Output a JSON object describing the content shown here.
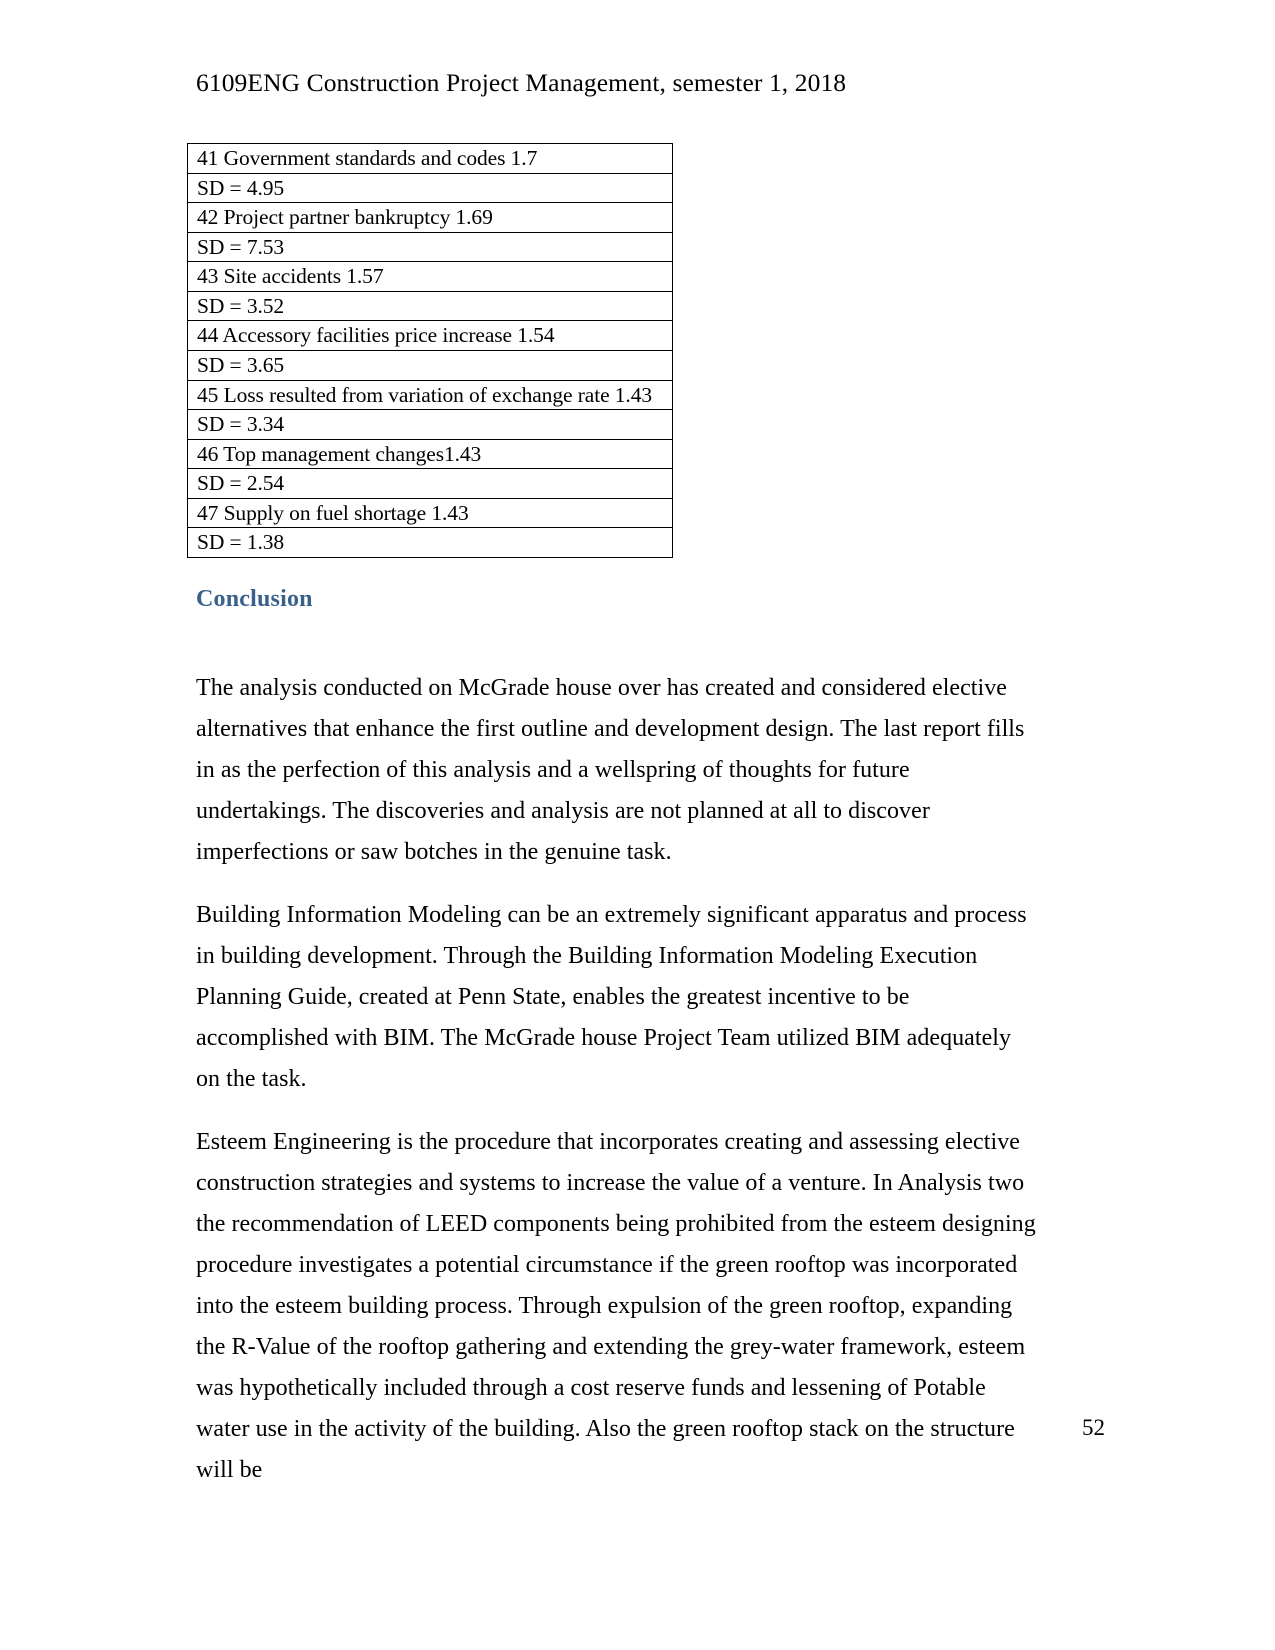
{
  "document": {
    "header": "6109ENG Construction Project Management, semester 1, 2018",
    "page_number": "52",
    "heading_color": "#38618c"
  },
  "risk_table": {
    "rows": [
      {
        "label": "41 Government standards and codes 1.7",
        "sd": "SD = 4.95"
      },
      {
        "label": "42 Project partner bankruptcy   1.69",
        "sd": "SD = 7.53"
      },
      {
        "label": "43 Site accidents 1.57",
        "sd": "SD = 3.52"
      },
      {
        "label": "44 Accessory facilities price increase  1.54",
        "sd": "SD = 3.65"
      },
      {
        "label": "45 Loss resulted from variation of exchange rate 1.43",
        "sd": "SD = 3.34"
      },
      {
        "label": "46 Top management  changes1.43",
        "sd": "SD = 2.54"
      },
      {
        "label": "47 Supply on fuel shortage 1.43",
        "sd": "SD = 1.38"
      }
    ]
  },
  "section": {
    "title": "Conclusion",
    "paragraphs": [
      "The analysis conducted on McGrade house over has created and considered elective alternatives that enhance the first outline and development design. The last report fills in as the perfection of this analysis and a wellspring of thoughts for future undertakings. The discoveries and analysis are not planned at all to discover imperfections or saw botches in the genuine task.",
      "Building Information Modeling can be an extremely significant apparatus and process in building development. Through the Building Information Modeling Execution Planning Guide, created at Penn State, enables the greatest incentive to be accomplished with BIM. The McGrade house Project Team utilized BIM adequately on the task.",
      "Esteem Engineering is the procedure that incorporates creating and assessing elective construction strategies and systems to increase the value of a venture. In Analysis two the recommendation of LEED components being prohibited from the esteem designing procedure investigates a potential circumstance if the green rooftop was incorporated into the esteem building process. Through expulsion of the green rooftop, expanding the R-Value of the rooftop gathering and extending the grey-water framework, esteem was hypothetically included through a cost reserve funds and lessening of Potable water use in the activity of the building. Also the green rooftop stack on the structure will be"
    ]
  }
}
